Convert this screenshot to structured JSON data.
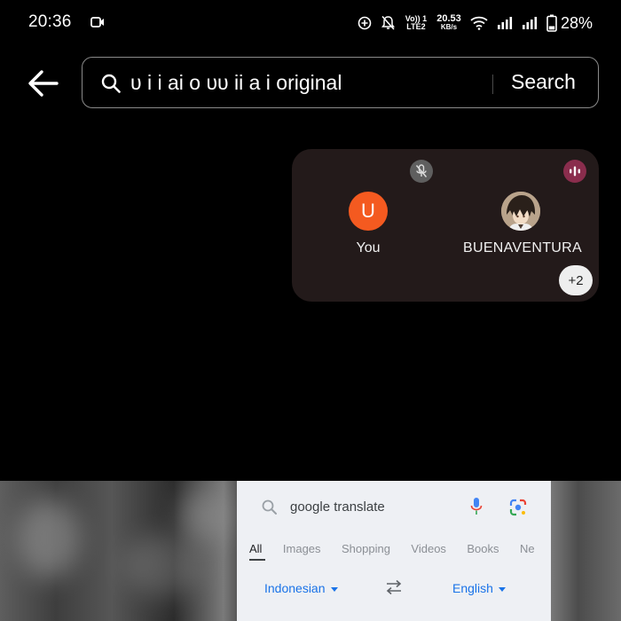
{
  "status_bar": {
    "time": "20:36",
    "volte_line1": "Vo)) 1",
    "volte_line2": "LTE2",
    "speed_value": "20.53",
    "speed_unit": "KB/s",
    "battery_percent": "28%",
    "icons": [
      "screen-record-icon",
      "add-circle-icon",
      "notifications-off-icon",
      "wifi-icon",
      "signal-icon",
      "signal-icon",
      "battery-icon"
    ]
  },
  "search": {
    "query": "ᴜ i i ai o ᴜᴜ ii a i original",
    "button_label": "Search"
  },
  "call": {
    "self_initial": "U",
    "self_name": "You",
    "other_name": "BUENAVENTURA",
    "more_count": "+2",
    "colors": {
      "card": "#231a1a",
      "self_avatar": "#f45a20",
      "speaking": "#8a2d4d",
      "mute": "#5f5f5f"
    }
  },
  "preview": {
    "query": "google translate",
    "tabs": [
      "All",
      "Images",
      "Shopping",
      "Videos",
      "Books",
      "Ne"
    ],
    "source_language": "Indonesian",
    "target_language": "English",
    "accent_color": "#1a73e8"
  }
}
